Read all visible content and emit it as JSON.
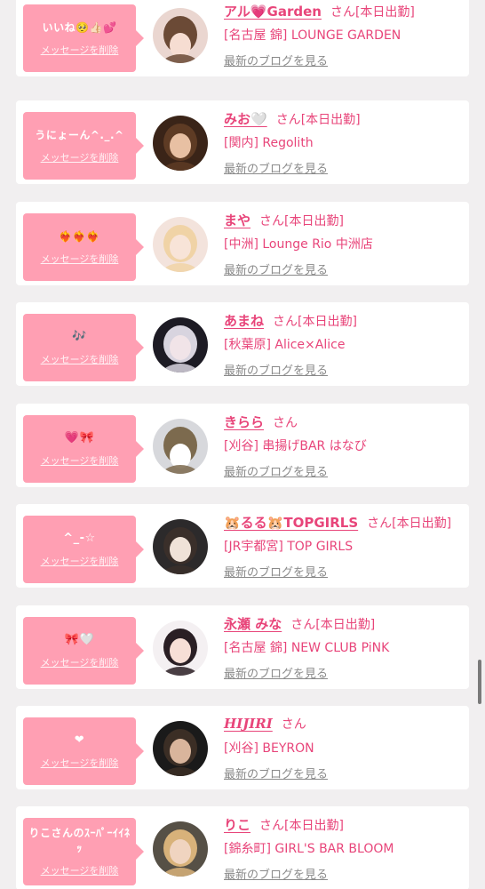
{
  "colors": {
    "accent": "#e8457a",
    "bubble": "#ff9fb3",
    "background": "#f1eff0"
  },
  "common": {
    "delete_label": "メッセージを削除",
    "blog_label": "最新のブログを見る",
    "honorific": "さん",
    "on_duty": "[本日出勤]"
  },
  "cards": [
    {
      "message": "いいね🥺👍🏻💕",
      "name": "アル💗Garden",
      "on_duty": true,
      "shop": "[名古屋 錦] LOUNGE GARDEN",
      "avatar": "avatar-photo-1"
    },
    {
      "message": "うにょーん^._.^",
      "name": "みお🤍",
      "on_duty": true,
      "shop": "[関内] Regolith",
      "avatar": "avatar-photo-2"
    },
    {
      "message": "❤️‍🔥❤️‍🔥❤️‍🔥",
      "name": "まや",
      "on_duty": true,
      "shop": "[中洲] Lounge Rio 中洲店",
      "avatar": "avatar-photo-3"
    },
    {
      "message": "🎶",
      "name": "あまね",
      "on_duty": true,
      "shop": "[秋葉原] Alice×Alice",
      "avatar": "avatar-photo-4"
    },
    {
      "message": "💗🎀",
      "name": "きらら",
      "on_duty": false,
      "shop": "[刈谷] 串揚げBAR はなび",
      "avatar": "avatar-photo-5"
    },
    {
      "message": "^_-☆",
      "name": "🐹るる🐹TOPGIRLS",
      "on_duty": true,
      "shop": "[JR宇都宮] TOP GIRLS",
      "avatar": "avatar-photo-6"
    },
    {
      "message": "🎀🤍",
      "name": "永瀬 みな",
      "on_duty": true,
      "shop": "[名古屋 錦] NEW CLUB PiNK",
      "avatar": "avatar-photo-7"
    },
    {
      "message": "❤",
      "name": "HIJIRI",
      "on_duty": false,
      "shop": "[刈谷] BEYRON",
      "avatar": "avatar-photo-8"
    },
    {
      "message": "りこさんのｽｰﾊﾟｰｲｲﾈｯ",
      "name": "りこ",
      "on_duty": true,
      "shop": "[錦糸町] GIRL'S BAR BLOOM",
      "avatar": "avatar-photo-9"
    }
  ]
}
